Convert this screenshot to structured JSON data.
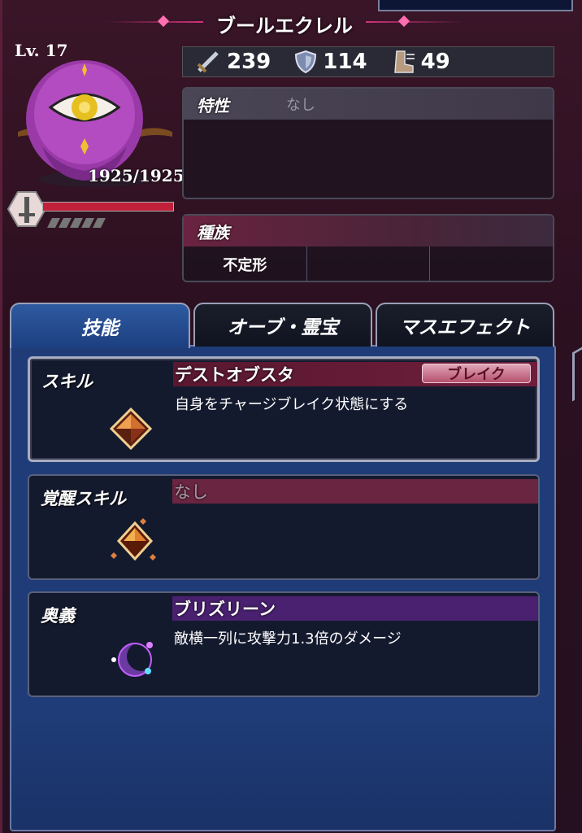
{
  "unit": {
    "name": "ブールエクレル",
    "level": "Lv. 17",
    "hp": "1925/1925",
    "hp_fraction": 1.0
  },
  "stats": {
    "attack": "239",
    "defense": "114",
    "speed": "49"
  },
  "trait": {
    "label": "特性",
    "value": "なし"
  },
  "race": {
    "label": "種族",
    "values": [
      "不定形",
      "",
      ""
    ]
  },
  "tabs": [
    {
      "label": "技能",
      "active": true
    },
    {
      "label": "オーブ・霊宝",
      "active": false
    },
    {
      "label": "マスエフェクト",
      "active": false
    }
  ],
  "skills": {
    "skill": {
      "kind": "スキル",
      "name": "デストオブスタ",
      "badge": "ブレイク",
      "desc": "自身をチャージブレイク状態にする"
    },
    "awaken": {
      "kind": "覚醒スキル",
      "name": "なし",
      "desc": ""
    },
    "ougi": {
      "kind": "奥義",
      "name": "ブリズリーン",
      "desc": "敵横一列に攻撃力1.3倍のダメージ"
    }
  },
  "colors": {
    "hp_bar": "#c0203a",
    "tab_active": "#2e5aa0",
    "content_bg": "#1f3c78"
  }
}
